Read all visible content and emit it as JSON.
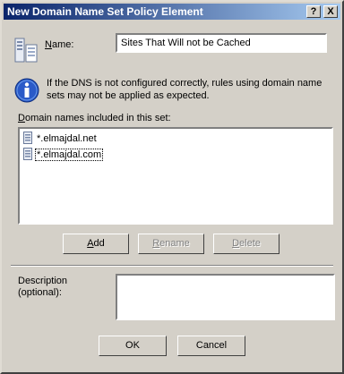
{
  "window": {
    "title": "New Domain Name Set Policy Element",
    "help_button": "?",
    "close_button": "X"
  },
  "name_field": {
    "label_accel": "N",
    "label_rest": "ame:",
    "value": "Sites That Will not be Cached"
  },
  "info": {
    "line1": "If the DNS is not configured correctly, rules using domain name",
    "line2": "sets may not be applied as expected."
  },
  "domain_list": {
    "label_accel": "D",
    "label_rest": "omain names included in this set:",
    "items": [
      "*.elmajdal.net",
      "*.elmajdal.com"
    ]
  },
  "buttons": {
    "add_accel": "A",
    "add_rest": "dd",
    "rename_accel": "R",
    "rename_rest": "ename",
    "delete_accel": "D",
    "delete_rest": "elete",
    "ok": "OK",
    "cancel": "Cancel"
  },
  "description": {
    "label_line1": "Description",
    "label_line2": "(optional):",
    "value": ""
  }
}
